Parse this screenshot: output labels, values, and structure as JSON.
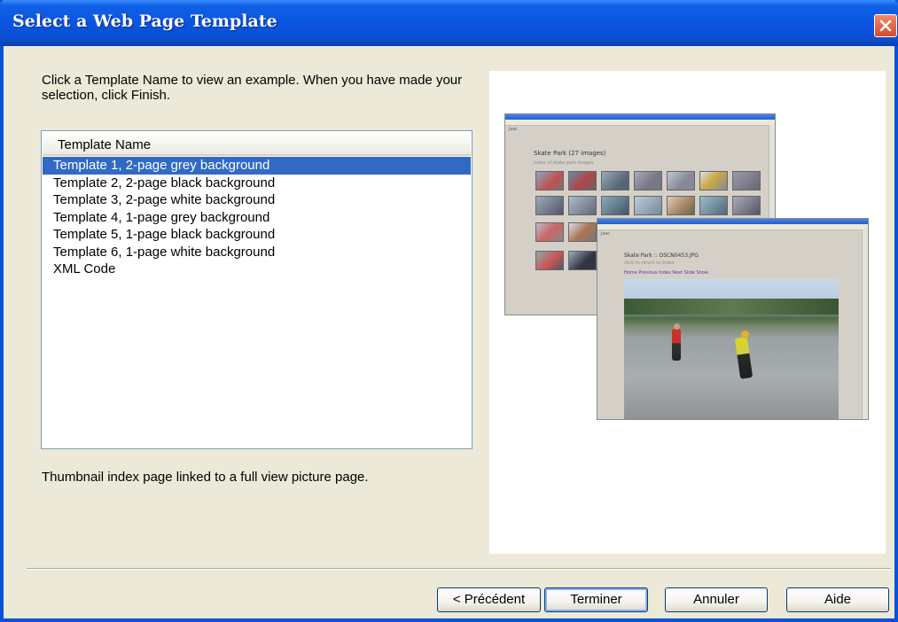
{
  "window": {
    "title": "Select a Web Page Template"
  },
  "instruction": "Click a Template Name to view an example. When you have made your selection, click Finish.",
  "list": {
    "header": "Template Name",
    "items": [
      "Template 1, 2-page grey background",
      "Template 2, 2-page black background",
      "Template 3, 2-page white background",
      "Template 4, 1-page grey background",
      "Template 5, 1-page black background",
      "Template 6, 1-page white background",
      "XML Code"
    ],
    "selected_index": 0
  },
  "description": "Thumbnail index page linked to a full view picture page.",
  "buttons": {
    "back": "< Précédent",
    "finish": "Terminer",
    "cancel": "Annuler",
    "help": "Aide"
  },
  "colors": {
    "titlebar": "#0a55e0",
    "selection": "#316ac5",
    "dialog_bg": "#ece9d8"
  },
  "icons": {
    "close": "close-icon"
  }
}
